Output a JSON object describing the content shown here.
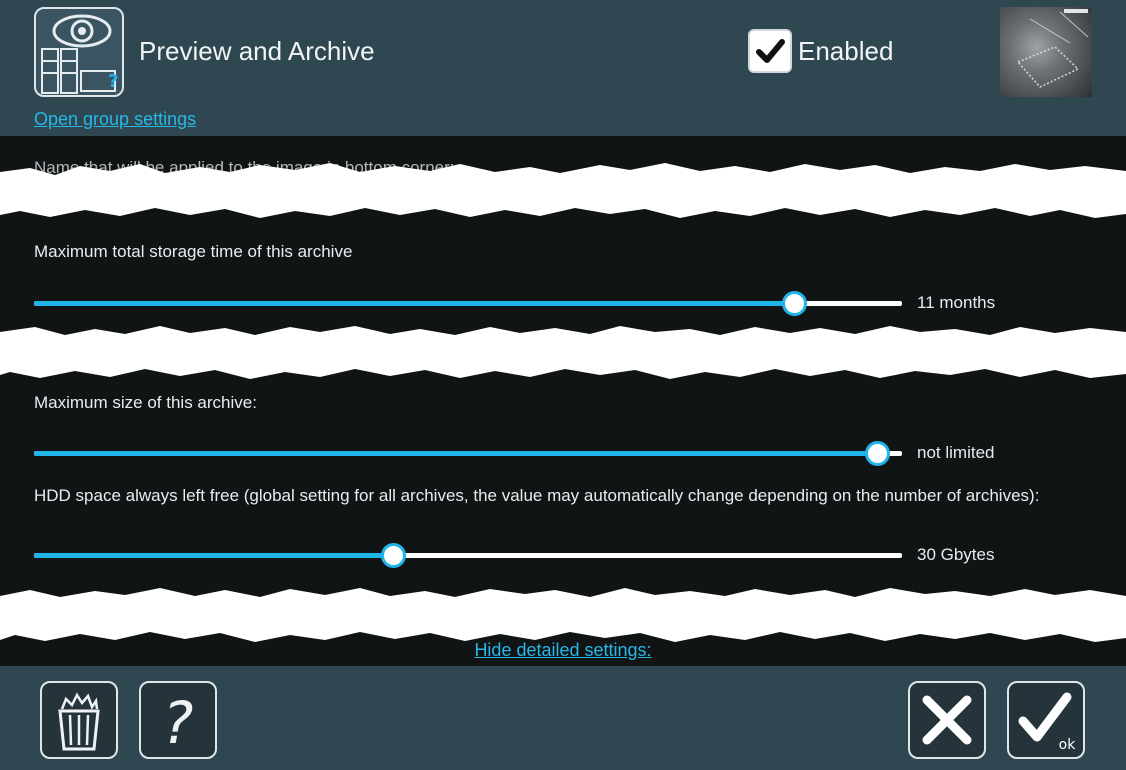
{
  "header": {
    "title": "Preview and Archive",
    "enabled_label": "Enabled",
    "enabled_checked": true,
    "open_group_link": "Open group settings",
    "module_icon": "eye-archive-icon"
  },
  "settings": {
    "name_label": "Name that will be applied to the image in bottom corner:",
    "storage_time": {
      "label": "Maximum total storage time of this archive",
      "value_text": "11 months",
      "fraction": 0.876
    },
    "archive_size": {
      "label": "Maximum size of this archive:",
      "value_text": "not limited",
      "fraction": 0.971
    },
    "hdd_free": {
      "label": "HDD space always left free (global setting for all archives, the value may automatically change depending on the number of archives):",
      "value_text": "30 Gbytes",
      "fraction": 0.414
    }
  },
  "hide_link": "Hide detailed settings:",
  "footer": {
    "delete_icon": "trash-icon",
    "help_icon": "help-icon",
    "cancel_icon": "close-icon",
    "ok_icon": "ok-check-icon",
    "ok_text": "ok"
  },
  "colors": {
    "header_bg": "#2f4751",
    "accent": "#20b5ea",
    "link": "#27b8e8"
  }
}
